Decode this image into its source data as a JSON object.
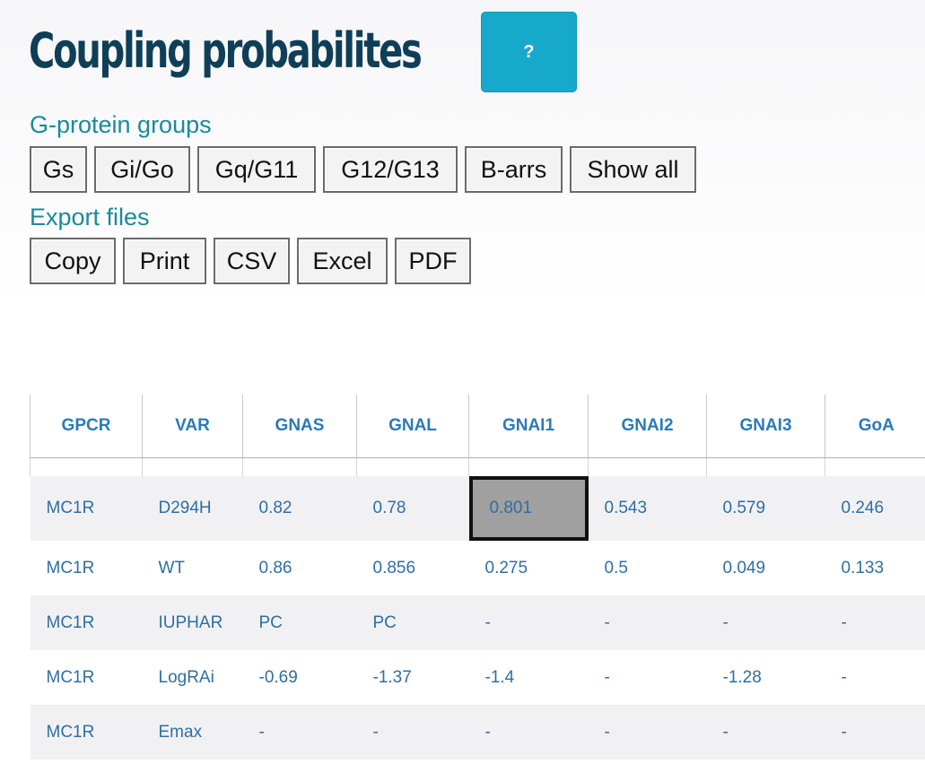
{
  "header": {
    "title": "Coupling probabilites",
    "help_label": "?"
  },
  "gprotein_groups": {
    "label": "G-protein groups",
    "buttons": [
      "Gs",
      "Gi/Go",
      "Gq/G11",
      "G12/G13",
      "B-arrs",
      "Show all"
    ]
  },
  "export": {
    "label": "Export files",
    "buttons": [
      "Copy",
      "Print",
      "CSV",
      "Excel",
      "PDF"
    ]
  },
  "table": {
    "columns": [
      "GPCR",
      "VAR",
      "GNAS",
      "GNAL",
      "GNAI1",
      "GNAI2",
      "GNAI3",
      "GoA"
    ],
    "rows": [
      [
        "MC1R",
        "D294H",
        "0.82",
        "0.78",
        "0.801",
        "0.543",
        "0.579",
        "0.246"
      ],
      [
        "MC1R",
        "WT",
        "0.86",
        "0.856",
        "0.275",
        "0.5",
        "0.049",
        "0.133"
      ],
      [
        "MC1R",
        "IUPHAR",
        "PC",
        "PC",
        "-",
        "-",
        "-",
        "-"
      ],
      [
        "MC1R",
        "LogRAi",
        "-0.69",
        "-1.37",
        "-1.4",
        "-",
        "-1.28",
        "-"
      ],
      [
        "MC1R",
        "Emax",
        "-",
        "-",
        "-",
        "-",
        "-",
        "-"
      ]
    ],
    "selected_cell": {
      "row": 0,
      "col": 4
    }
  },
  "colors": {
    "title": "#0f3f57",
    "help_button": "#17a9cb",
    "section_label": "#1a8a9a",
    "header_text": "#2b7bb7",
    "cell_text": "#2f6ea2",
    "selected_cell_bg": "#a0a0a0"
  }
}
